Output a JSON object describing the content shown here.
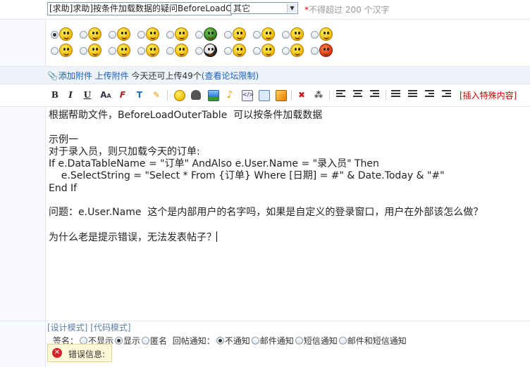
{
  "title": {
    "subject_value": "[求助]求助]按条件加载数据的疑问BeforeLoadO",
    "category_selected": "其它",
    "limit_hint": "不得超过 200 个汉字",
    "required_mark": "*"
  },
  "smilies": {
    "selected_index": 0,
    "count": 20
  },
  "attach": {
    "add": "添加附件",
    "upload": "上传附件",
    "info": "今天还可上传49个",
    "limit_link": "(查看论坛限制)"
  },
  "toolbar": {
    "bold": "B",
    "italic": "I",
    "underline": "U",
    "special": "[插入特殊内容]"
  },
  "editor": {
    "lines": [
      "根据帮助文件，BeforeLoadOuterTable  可以按条件加载数据",
      "",
      "示例一",
      "对于录入员，则只加载今天的订单:",
      "If e.DataTableName = \"订单\" AndAlso e.User.Name = \"录入员\" Then",
      "    e.SelectString = \"Select * From {订单} Where [日期] = #\" & Date.Today & \"#\"",
      "End If",
      "",
      "问题：e.User.Name  这个是内部用户的名字吗，如果是自定义的登录窗口，用户在外部该怎么做？",
      "",
      "为什么老是提示错误，无法发表帖子？"
    ]
  },
  "modes": {
    "design": "[设计模式]",
    "code": "[代码模式]"
  },
  "options": {
    "sig_label": "签名：",
    "sig_hide": "不显示",
    "sig_show": "显示",
    "anon": "匿名",
    "notify_label": "回帖通知：",
    "n_none": "不通知",
    "n_mail": "邮件通知",
    "n_sms": "短信通知",
    "n_both": "邮件和短信通知"
  },
  "error": {
    "label": "错误信息:"
  }
}
